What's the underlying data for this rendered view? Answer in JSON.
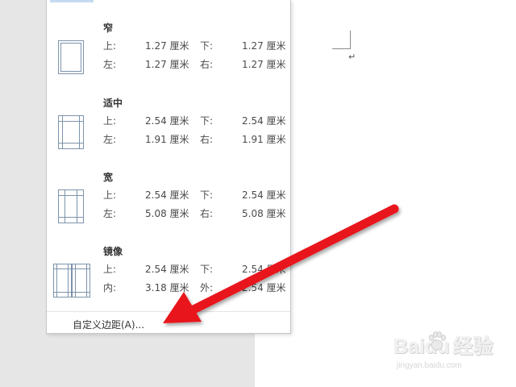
{
  "document": {
    "paragraph_mark": "↵"
  },
  "margins_menu": {
    "presets": [
      {
        "name": "窄",
        "rows": [
          {
            "l1": "上:",
            "v1": "1.27 厘米",
            "l2": "下:",
            "v2": "1.27 厘米"
          },
          {
            "l1": "左:",
            "v1": "1.27 厘米",
            "l2": "右:",
            "v2": "1.27 厘米"
          }
        ]
      },
      {
        "name": "适中",
        "rows": [
          {
            "l1": "上:",
            "v1": "2.54 厘米",
            "l2": "下:",
            "v2": "2.54 厘米"
          },
          {
            "l1": "左:",
            "v1": "1.91 厘米",
            "l2": "右:",
            "v2": "1.91 厘米"
          }
        ]
      },
      {
        "name": "宽",
        "rows": [
          {
            "l1": "上:",
            "v1": "2.54 厘米",
            "l2": "下:",
            "v2": "2.54 厘米"
          },
          {
            "l1": "左:",
            "v1": "5.08 厘米",
            "l2": "右:",
            "v2": "5.08 厘米"
          }
        ]
      },
      {
        "name": "镜像",
        "rows": [
          {
            "l1": "上:",
            "v1": "2.54 厘米",
            "l2": "下:",
            "v2": "2.54 厘米"
          },
          {
            "l1": "内:",
            "v1": "3.18 厘米",
            "l2": "外:",
            "v2": "2.54 厘米"
          }
        ]
      }
    ],
    "custom_margins_label": "自定义边距(A)..."
  },
  "annotation": {
    "arrow_color": "#e8141c"
  },
  "watermark": {
    "brand": "Baidu",
    "cn": "经验",
    "url": "jingyan.baidu.com"
  }
}
